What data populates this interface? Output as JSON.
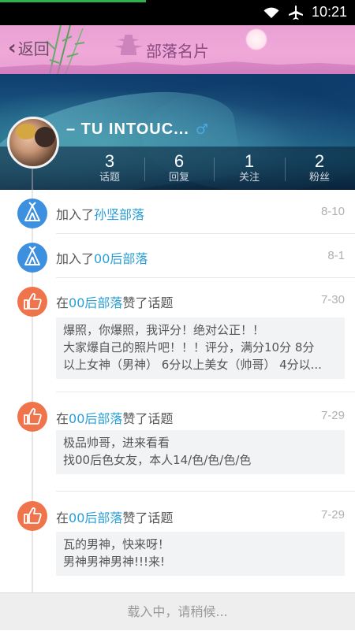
{
  "status_bar": {
    "time": "10:21",
    "wifi_icon": "wifi-icon",
    "airplane_icon": "airplane-icon"
  },
  "header": {
    "back_label": "返回",
    "title": "部落名片"
  },
  "profile": {
    "username": "–   TU   INTOUC...",
    "gender_symbol": "♂",
    "stats": [
      {
        "value": "3",
        "label": "话题"
      },
      {
        "value": "6",
        "label": "回复"
      },
      {
        "value": "1",
        "label": "关注"
      },
      {
        "value": "2",
        "label": "粉丝"
      }
    ]
  },
  "feed": [
    {
      "icon": "tent-icon",
      "prefix": "加入了",
      "link": "孙坚部落",
      "suffix": "",
      "date": "8-10"
    },
    {
      "icon": "tent-icon",
      "prefix": "加入了",
      "link": "00后部落",
      "suffix": "",
      "date": "8-1"
    },
    {
      "icon": "thumbs-up-icon",
      "prefix": "在",
      "link": "00后部落",
      "suffix": "赞了话题",
      "date": "7-30",
      "quote": [
        "爆照，你爆照，我评分！绝对公正！！",
        "大家爆自己的照片吧！！！评分，满分10分 8分",
        "以上女神（男神） 6分以上美女（帅哥） 4分以..."
      ]
    },
    {
      "icon": "thumbs-up-icon",
      "prefix": "在",
      "link": "00后部落",
      "suffix": "赞了话题",
      "date": "7-29",
      "quote": [
        "极品帅哥，进来看看",
        "找00后色女友，本人14/色/色/色/色"
      ]
    },
    {
      "icon": "thumbs-up-icon",
      "prefix": "在",
      "link": "00后部落",
      "suffix": "赞了话题",
      "date": "7-29",
      "quote": [
        "瓦的男神，快来呀！",
        "男神男神男神!!!来!"
      ]
    }
  ],
  "footer": {
    "loading_text": "载入中，请稍候..."
  },
  "colors": {
    "link": "#2a9fd6",
    "tent_icon_bg": "#3d8fe0",
    "thumb_icon_bg": "#f0744b",
    "title_bar": "#f0a8d9"
  }
}
